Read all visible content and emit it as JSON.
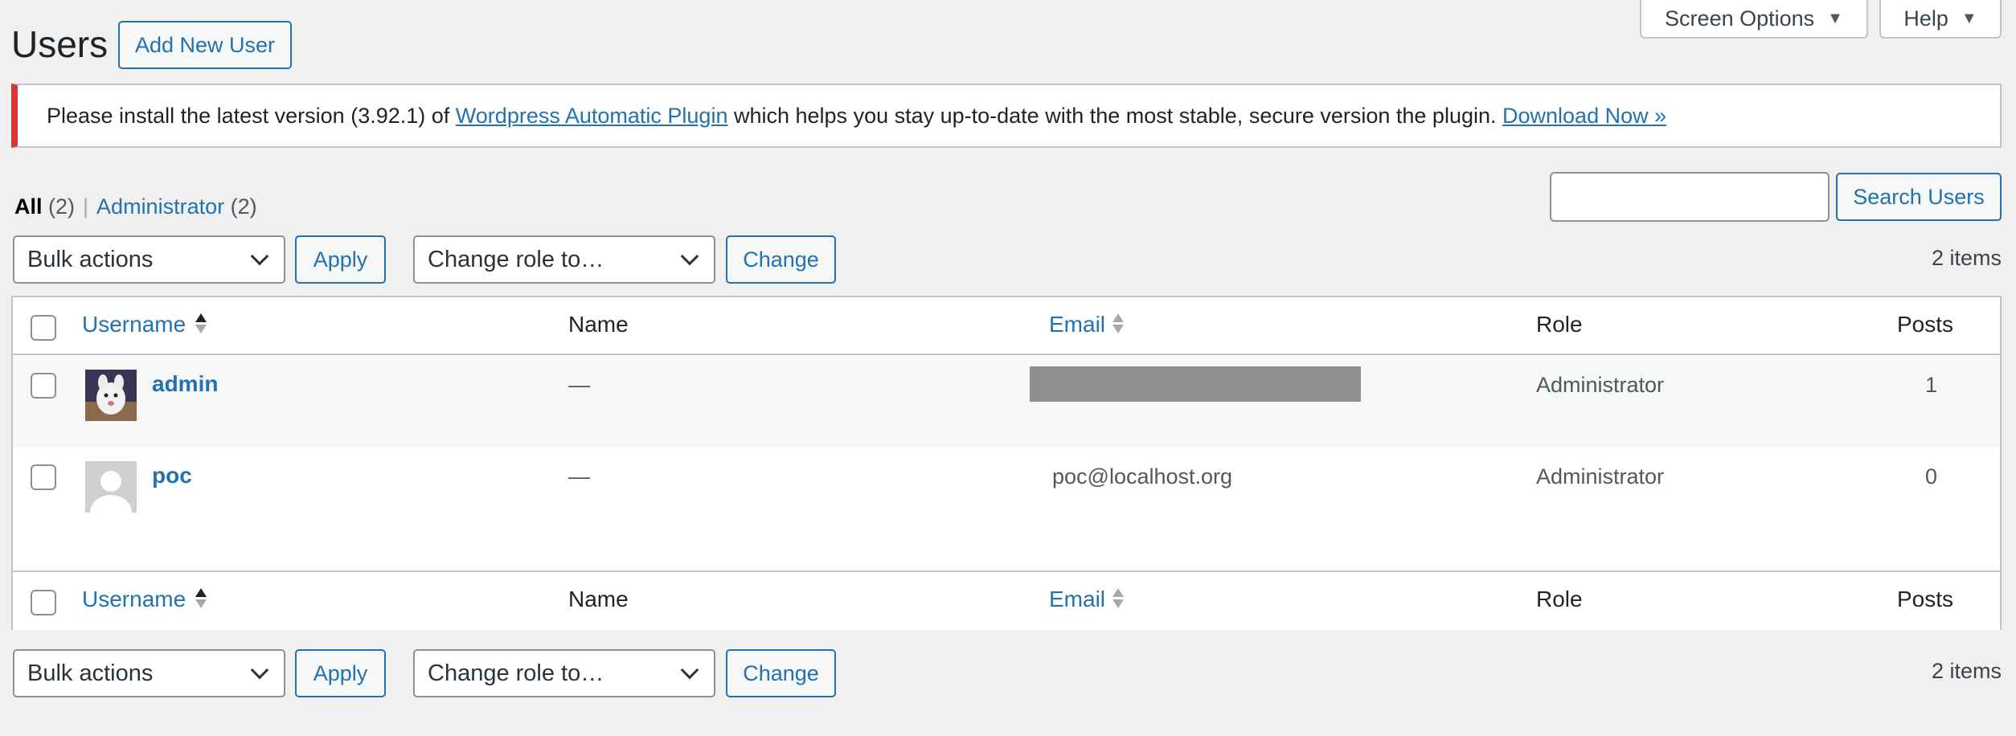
{
  "header": {
    "title": "Users",
    "add_new_label": "Add New User",
    "screen_options_label": "Screen Options",
    "help_label": "Help"
  },
  "notice": {
    "text_before": "Please install the latest version (3.92.1) of",
    "plugin_link": "Wordpress Automatic Plugin",
    "text_after": "which helps you stay up-to-date with the most stable, secure version the plugin.",
    "download_link": "Download Now »"
  },
  "views": {
    "all_label": "All",
    "all_count": "(2)",
    "separator": "|",
    "admin_label": "Administrator",
    "admin_count": "(2)"
  },
  "search": {
    "value": "",
    "button_label": "Search Users"
  },
  "tablenav_top": {
    "bulk_selected": "Bulk actions",
    "apply_label": "Apply",
    "role_selected": "Change role to…",
    "change_label": "Change",
    "count": "2 items"
  },
  "tablenav_bottom": {
    "bulk_selected": "Bulk actions",
    "apply_label": "Apply",
    "role_selected": "Change role to…",
    "change_label": "Change",
    "count": "2 items"
  },
  "table": {
    "columns": {
      "username": "Username",
      "name": "Name",
      "email": "Email",
      "role": "Role",
      "posts": "Posts"
    },
    "rows": [
      {
        "username": "admin",
        "name": "—",
        "email": "",
        "email_redacted": true,
        "role": "Administrator",
        "posts": "1"
      },
      {
        "username": "poc",
        "name": "—",
        "email": "poc@localhost.org",
        "email_redacted": false,
        "role": "Administrator",
        "posts": "0"
      }
    ]
  },
  "colors": {
    "accent": "#2271b1",
    "notice_border": "#d63638",
    "page_bg": "#f0f0f1"
  }
}
